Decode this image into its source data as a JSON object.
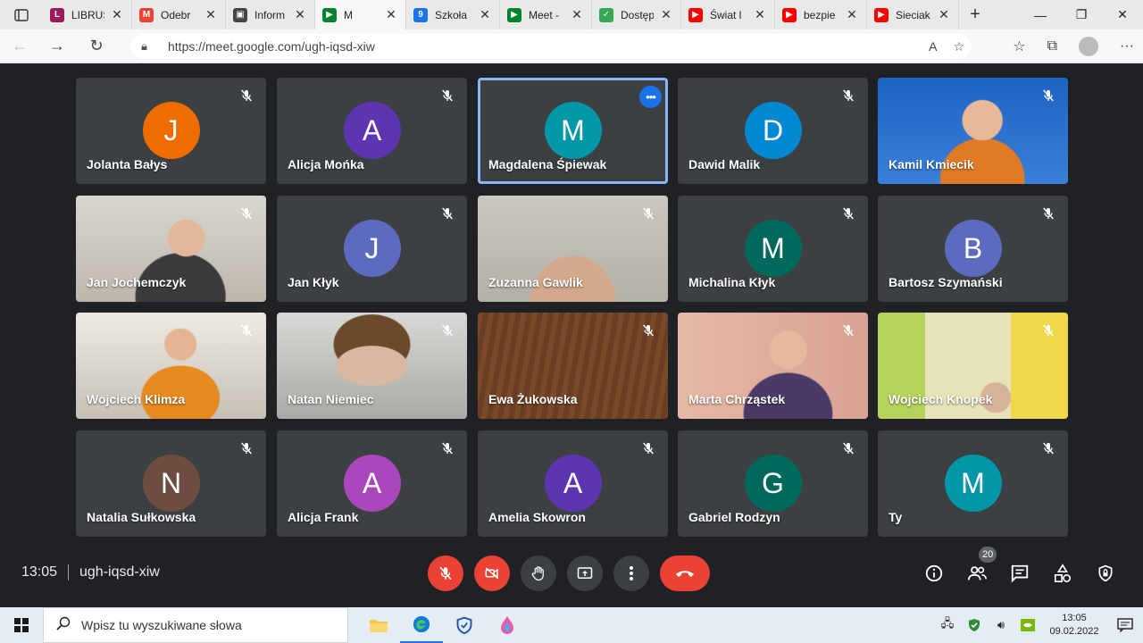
{
  "browser": {
    "tabs": [
      {
        "title": "LIBRUS",
        "color": "#9c1c5b",
        "glyph": "L"
      },
      {
        "title": "Odebr",
        "color": "#ea4335",
        "glyph": "M"
      },
      {
        "title": "Inform",
        "color": "#444444",
        "glyph": "▣"
      },
      {
        "title": "M",
        "color": "#00832d",
        "glyph": "▶",
        "active": true
      },
      {
        "title": "Szkoła",
        "color": "#1a73e8",
        "glyph": "9"
      },
      {
        "title": "Meet -",
        "color": "#00832d",
        "glyph": "▶"
      },
      {
        "title": "Dostęp",
        "color": "#34a853",
        "glyph": "✓"
      },
      {
        "title": "Świat l",
        "color": "#ff0000",
        "glyph": "▶"
      },
      {
        "title": "bezpie",
        "color": "#ff0000",
        "glyph": "▶"
      },
      {
        "title": "Sieciak",
        "color": "#ff0000",
        "glyph": "▶"
      }
    ],
    "url": "https://meet.google.com/ugh-iqsd-xiw"
  },
  "participants": [
    {
      "name": "Jolanta Bałys",
      "initial": "J",
      "color": "#ef6c00"
    },
    {
      "name": "Alicja Mońka",
      "initial": "A",
      "color": "#5e35b1"
    },
    {
      "name": "Magdalena Śpiewak",
      "initial": "M",
      "color": "#0097a7",
      "highlight": true
    },
    {
      "name": "Dawid Malik",
      "initial": "D",
      "color": "#0288d1"
    },
    {
      "name": "Kamil Kmiecik",
      "video": "blue"
    },
    {
      "name": "Jan Jochemczyk",
      "video": "room"
    },
    {
      "name": "Jan Kłyk",
      "initial": "J",
      "color": "#5c6bc0"
    },
    {
      "name": "Zuzanna Gawlik",
      "video": "wall"
    },
    {
      "name": "Michalina Kłyk",
      "initial": "M",
      "color": "#00695c"
    },
    {
      "name": "Bartosz Szymański",
      "initial": "B",
      "color": "#5c6bc0"
    },
    {
      "name": "Wojciech Klimza",
      "video": "orange"
    },
    {
      "name": "Natan Niemiec",
      "video": "face"
    },
    {
      "name": "Ewa Żukowska",
      "video": "wood"
    },
    {
      "name": "Marta Chrząstek",
      "video": "pink"
    },
    {
      "name": "Wojciech Knopek",
      "video": "green"
    },
    {
      "name": "Natalia Sułkowska",
      "initial": "N",
      "color": "#6d4c41"
    },
    {
      "name": "Alicja Frank",
      "initial": "A",
      "color": "#ab47bc"
    },
    {
      "name": "Amelia Skowron",
      "initial": "A",
      "color": "#5e35b1"
    },
    {
      "name": "Gabriel Rodzyn",
      "initial": "G",
      "color": "#00695c"
    },
    {
      "name": "Ty",
      "initial": "M",
      "color": "#0097a7"
    }
  ],
  "meet": {
    "time": "13:05",
    "code": "ugh-iqsd-xiw",
    "people_count": "20"
  },
  "taskbar": {
    "search_placeholder": "Wpisz tu wyszukiwane słowa",
    "clock_time": "13:05",
    "clock_date": "09.02.2022"
  }
}
